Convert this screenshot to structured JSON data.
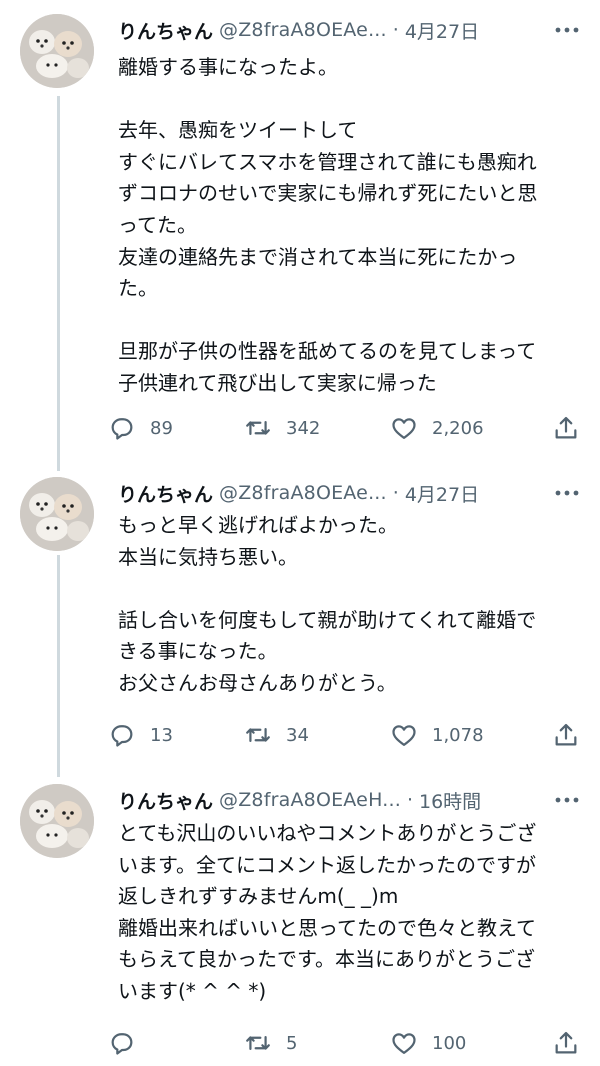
{
  "tweets": [
    {
      "display_name": "りんちゃん",
      "handle": "@Z8fraA8OEAe...",
      "time": "4月27日",
      "lines": [
        "離婚する事になったよ。",
        "",
        "去年、愚痴をツイートして",
        "すぐにバレてスマホを管理されて誰にも愚痴れ",
        "ずコロナのせいで実家にも帰れず死にたいと思",
        "ってた。",
        "友達の連絡先まで消されて本当に死にたかっ",
        "た。",
        "",
        "旦那が子供の性器を舐めてるのを見てしまって",
        "子供連れて飛び出して実家に帰った"
      ],
      "replies": "89",
      "retweets": "342",
      "likes": "2,206"
    },
    {
      "display_name": "りんちゃん",
      "handle": "@Z8fraA8OEAe...",
      "time": "4月27日",
      "lines": [
        "もっと早く逃げればよかった。",
        "本当に気持ち悪い。",
        "",
        "話し合いを何度もして親が助けてくれて離婚で",
        "きる事になった。",
        "お父さんお母さんありがとう。"
      ],
      "replies": "13",
      "retweets": "34",
      "likes": "1,078"
    },
    {
      "display_name": "りんちゃん",
      "handle": "@Z8fraA8OEAeH...",
      "time": "16時間",
      "lines": [
        "とても沢山のいいねやコメントありがとうござ",
        "います。全てにコメント返したかったのですが",
        "返しきれずすみませんm(_ _)m",
        "離婚出来ればいいと思ってたので色々と教えて",
        "もらえて良かったです。本当にありがとうござ",
        "います(* ^ ^ *)"
      ],
      "replies": "",
      "retweets": "5",
      "likes": "100"
    }
  ],
  "icons": {
    "reply": "reply-icon",
    "retweet": "retweet-icon",
    "like": "heart-icon",
    "share": "share-icon",
    "more": "more-icon"
  },
  "colors": {
    "text": "#0f1419",
    "secondary": "#536471",
    "thread_line": "#cfd9de"
  }
}
